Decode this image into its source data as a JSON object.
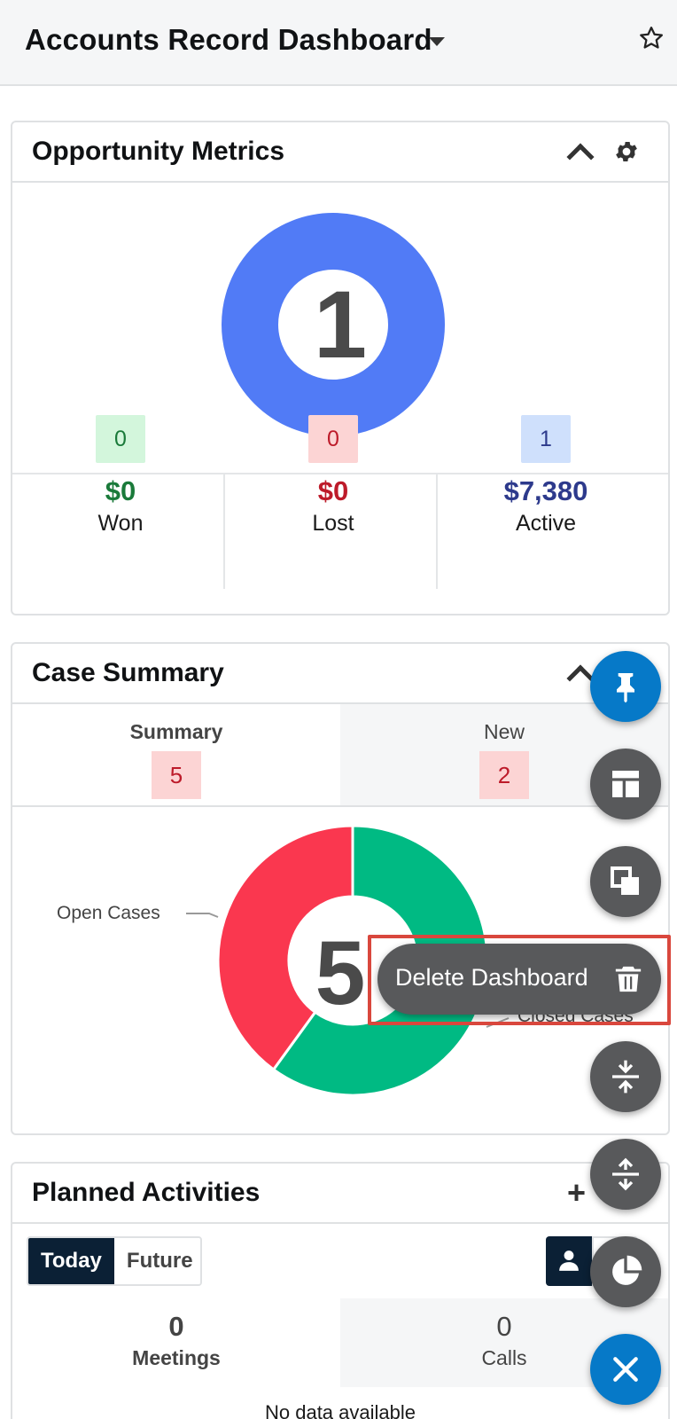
{
  "header": {
    "title": "Accounts Record Dashboard"
  },
  "opportunity_metrics": {
    "title": "Opportunity Metrics",
    "donut_total": "1",
    "columns": [
      {
        "count": "0",
        "amount": "$0",
        "label": "Won",
        "badge_bg": "#d3f6dc",
        "badge_fg": "#1a7a3a",
        "amount_color": "#1a7a3a"
      },
      {
        "count": "0",
        "amount": "$0",
        "label": "Lost",
        "badge_bg": "#fcd4d4",
        "badge_fg": "#bd1b2a",
        "amount_color": "#bd1b2a"
      },
      {
        "count": "1",
        "amount": "$7,380",
        "label": "Active",
        "badge_bg": "#cfe0fc",
        "badge_fg": "#2d3a8c",
        "amount_color": "#2d3a8c"
      }
    ],
    "donut_color": "#517bf6"
  },
  "case_summary": {
    "title": "Case Summary",
    "tabs": [
      {
        "label": "Summary",
        "count": "5"
      },
      {
        "label": "New",
        "count": "2"
      }
    ],
    "donut_total": "5",
    "chart_data": {
      "type": "pie",
      "categories": [
        "Open Cases",
        "Closed Cases"
      ],
      "values": [
        2,
        3
      ],
      "colors": [
        "#fa374f",
        "#00ba83"
      ]
    }
  },
  "planned_activities": {
    "title": "Planned Activities",
    "add_label": "+",
    "filters": [
      "Today",
      "Future"
    ],
    "columns": [
      {
        "count": "0",
        "label": "Meetings"
      },
      {
        "count": "0",
        "label": "Calls"
      }
    ],
    "empty_text": "No data available"
  },
  "fab_menu": {
    "delete_label": "Delete Dashboard",
    "pin_color": "#0679c8",
    "close_color": "#0679c8"
  }
}
